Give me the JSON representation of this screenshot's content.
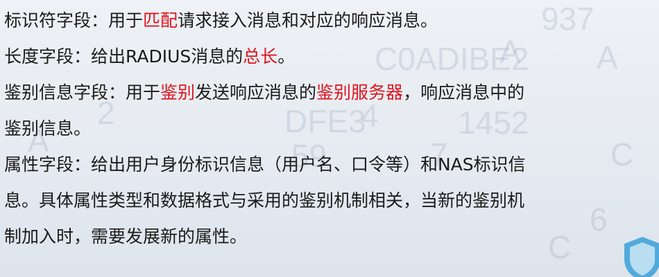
{
  "paragraphs": {
    "id_field": {
      "label": "标识符字段：用于",
      "hl1": "匹配",
      "rest": "请求接入消息和对应的响应消息。"
    },
    "length_field": {
      "label": "长度字段：给出RADIUS消息的",
      "hl1": "总长",
      "rest": "。"
    },
    "auth_field": {
      "label": "鉴别信息字段：用于",
      "hl1": "鉴别",
      "mid": "发送响应消息的",
      "hl2": "鉴别服务器",
      "rest": "，响应消息中的",
      "line2": "鉴别信息。"
    },
    "attr_field": {
      "line1": "属性字段：给出用户身份标识信息（用户名、口令等）和NAS标识信",
      "line2": "息。具体属性类型和数据格式与采用的鉴别机制相关，当新的鉴别机",
      "line3": "制加入时，需要发展新的属性。"
    }
  },
  "colors": {
    "highlight": "#e0141e",
    "text": "#1a1a1a"
  }
}
